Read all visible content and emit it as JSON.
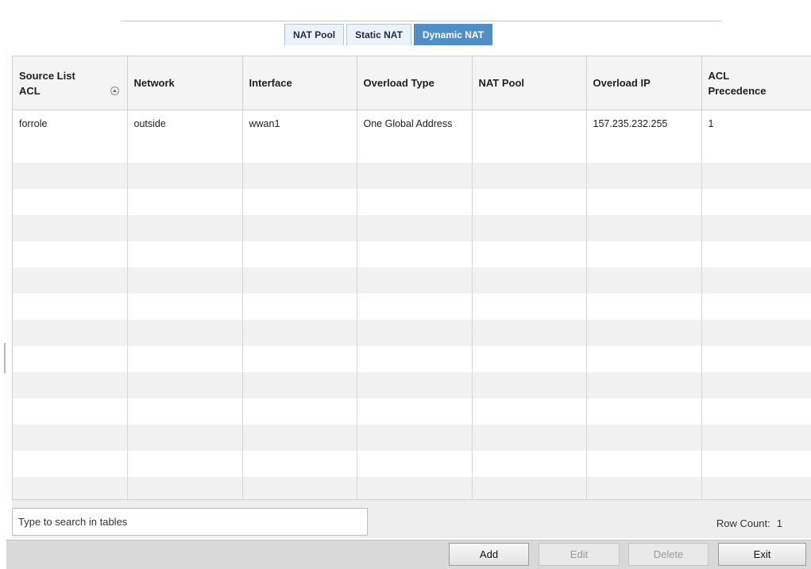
{
  "tabs": [
    {
      "label": "NAT Pool",
      "active": false
    },
    {
      "label": "Static NAT",
      "active": false
    },
    {
      "label": "Dynamic NAT",
      "active": true
    }
  ],
  "table": {
    "columns": [
      "Source List ACL",
      "Network",
      "Interface",
      "Overload Type",
      "NAT Pool",
      "Overload IP",
      "ACL Precedence"
    ],
    "sorted_column": "Source List ACL",
    "rows": [
      {
        "source_list_acl": "forrole",
        "network": "outside",
        "interface": "wwan1",
        "overload_type": "One Global Address",
        "nat_pool": "",
        "overload_ip": "157.235.232.255",
        "acl_precedence": "1"
      }
    ]
  },
  "search": {
    "placeholder": "Type to search in tables",
    "value": ""
  },
  "row_count": {
    "label": "Row Count:",
    "value": "1"
  },
  "buttons": {
    "add": "Add",
    "edit": "Edit",
    "delete": "Delete",
    "exit": "Exit"
  },
  "colors": {
    "active_tab": "#4f8fc6",
    "tab_bg": "#eaf2fa",
    "header_bg": "#f4f4f4",
    "stripe": "#f1f1f1",
    "footer_bg": "#d9d9d9"
  },
  "icons": {
    "sort": "sort-ascending-icon"
  }
}
